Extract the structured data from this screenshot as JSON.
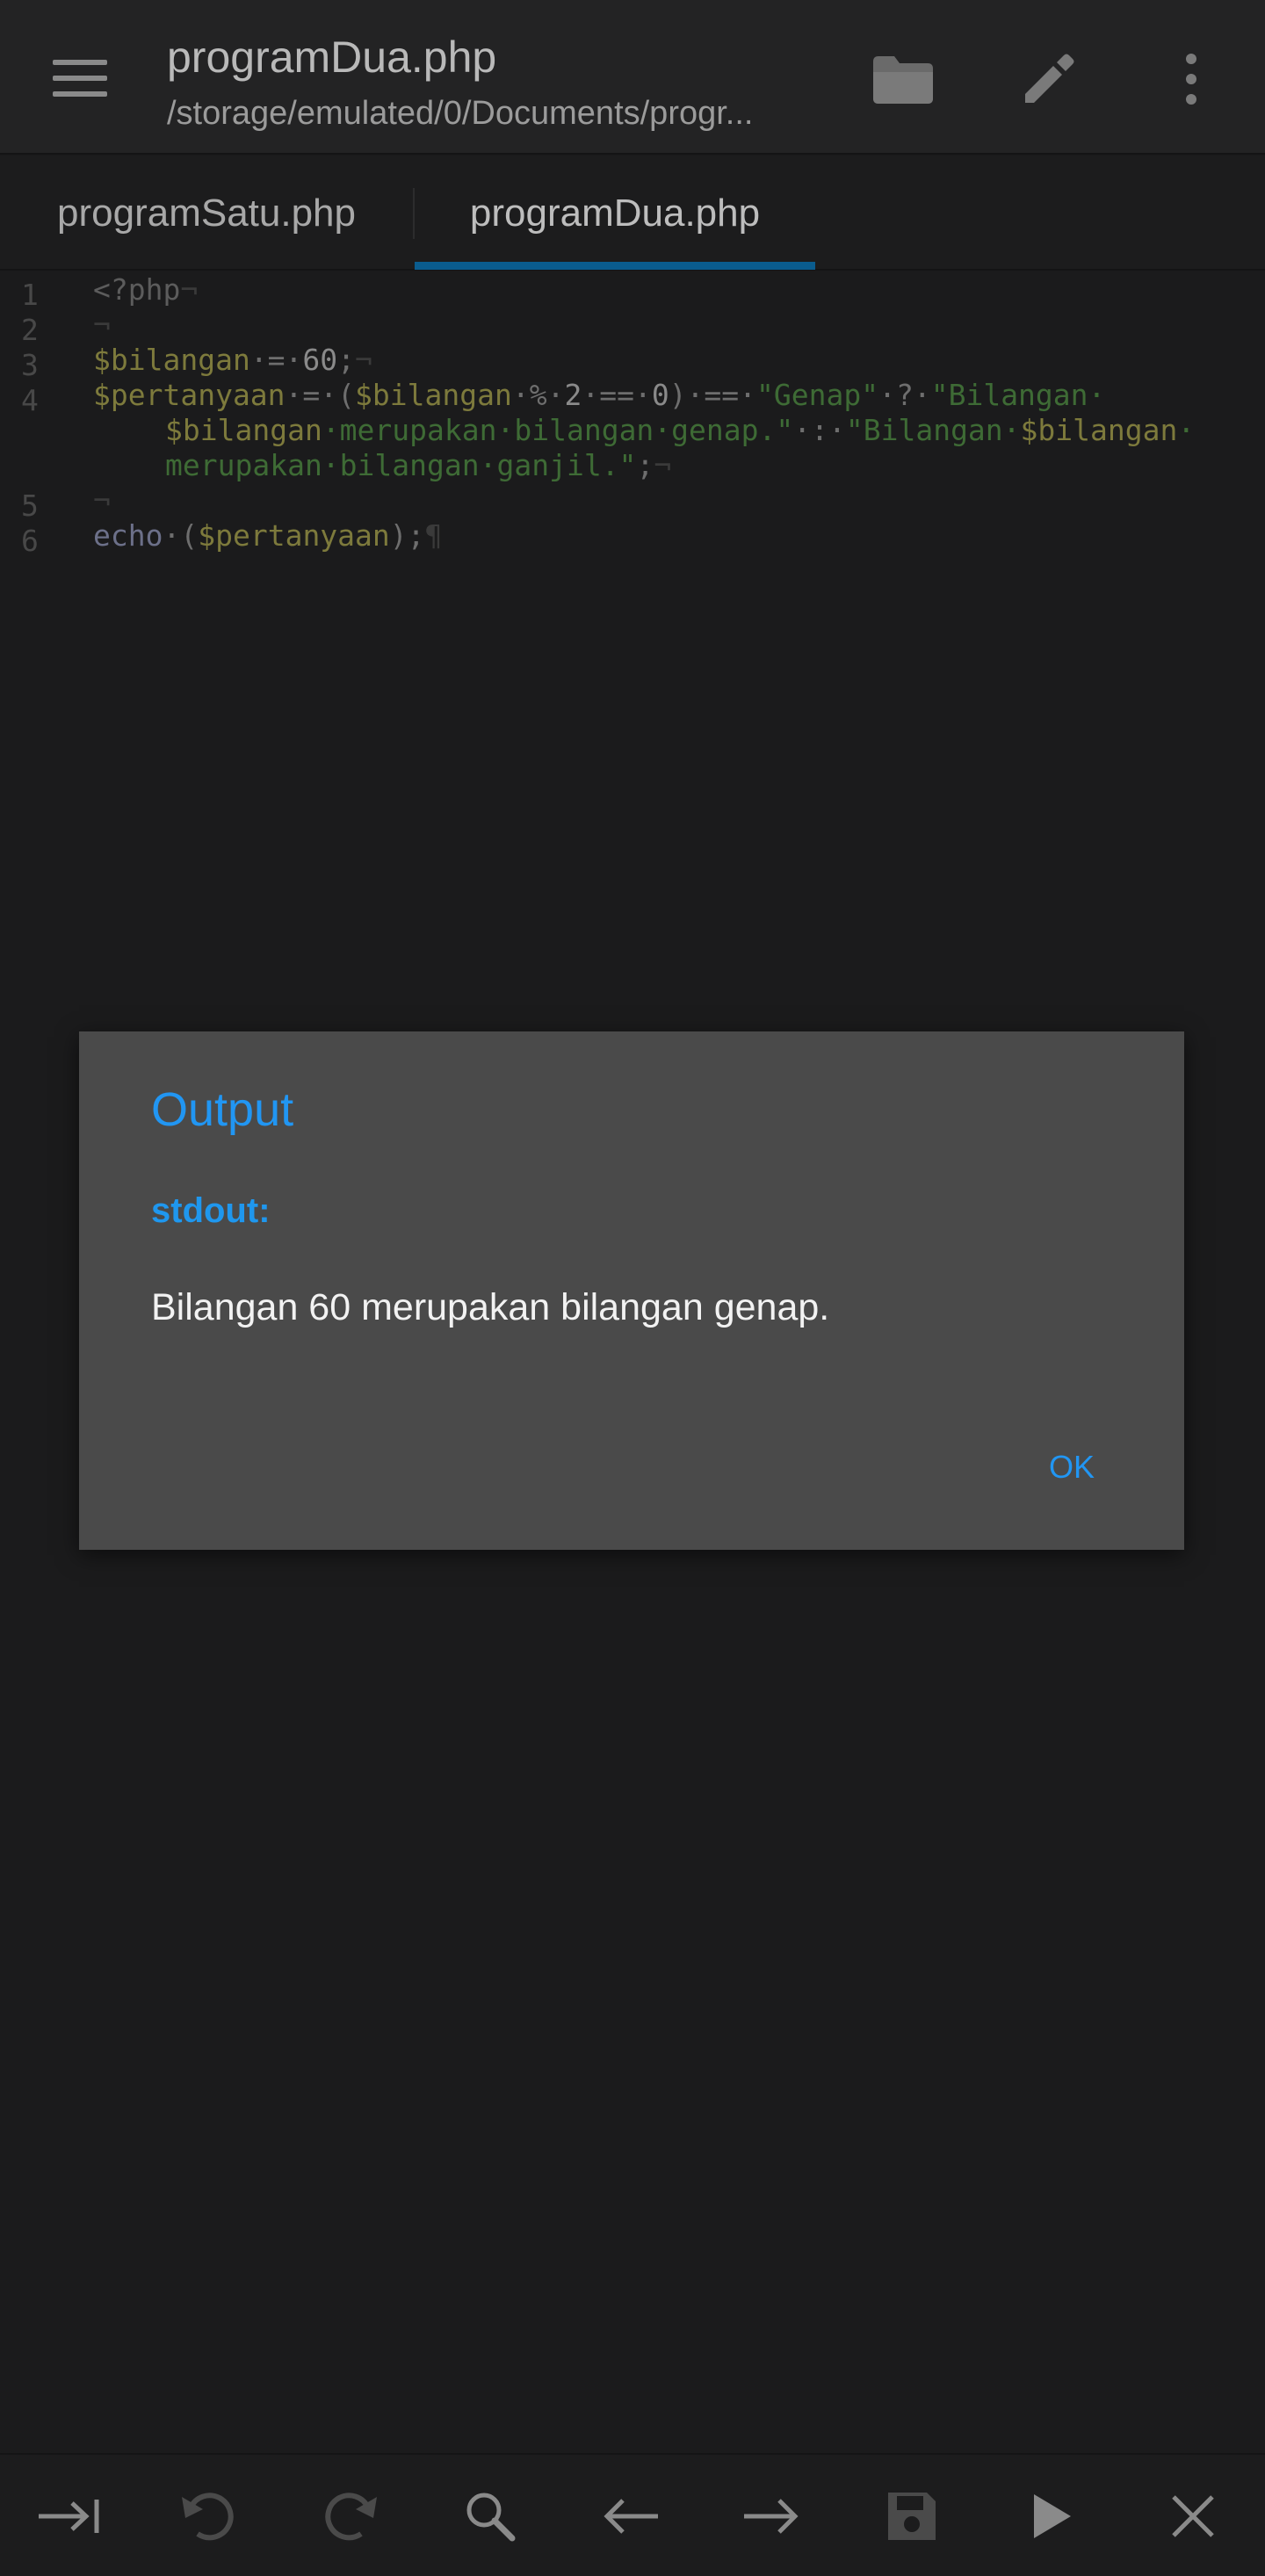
{
  "appbar": {
    "title": "programDua.php",
    "subtitle": "/storage/emulated/0/Documents/progr...",
    "icons": [
      "menu-icon",
      "folder-icon",
      "edit-icon",
      "more-vert-icon"
    ]
  },
  "tabs": [
    {
      "label": "programSatu.php",
      "active": false
    },
    {
      "label": "programDua.php",
      "active": true
    }
  ],
  "editor": {
    "line_numbers": [
      "1",
      "2",
      "3",
      "4",
      "5",
      "6"
    ],
    "lines": {
      "l1": {
        "tag": "<?php",
        "eol": "¬"
      },
      "l2": {
        "eol": "¬"
      },
      "l3": {
        "var": "$bilangan",
        "op1": "·=·",
        "num": "60",
        "end": ";",
        "eol": "¬"
      },
      "l4a": {
        "var": "$pertanyaan",
        "op1": "·=·(",
        "var2": "$bilangan",
        "op2": "·%·",
        "num1": "2",
        "op3": "·==·",
        "num2": "0",
        "op4": ")·==·",
        "str1": "\"Genap\"",
        "op5": "·?·",
        "str2": "\"Bilangan·"
      },
      "l4b": {
        "var": "$bilangan",
        "str": "·merupakan·bilangan·genap.\"",
        "op": "·:·",
        "str2": "\"Bilangan·",
        "var2": "$bilangan",
        "tail": "·"
      },
      "l4c": {
        "str": "merupakan·bilangan·ganjil.\"",
        "end": ";",
        "eol": "¬"
      },
      "l5": {
        "eol": "¬"
      },
      "l6": {
        "fn": "echo",
        "op": "·(",
        "var": "$pertanyaan",
        "end": ");",
        "eol": "¶"
      }
    }
  },
  "dialog": {
    "title": "Output",
    "label": "stdout:",
    "message": "Bilangan 60 merupakan bilangan genap.",
    "ok_label": "OK"
  },
  "toolbar": {
    "icons": [
      "indent-icon",
      "undo-icon",
      "redo-icon",
      "search-icon",
      "arrow-left-icon",
      "arrow-right-icon",
      "save-icon",
      "run-icon",
      "close-icon"
    ]
  },
  "colors": {
    "accent": "#2196f3",
    "tab_indicator": "#0a5c8e",
    "dialog_bg": "#4a4a4a",
    "background": "#1b1b1c"
  }
}
